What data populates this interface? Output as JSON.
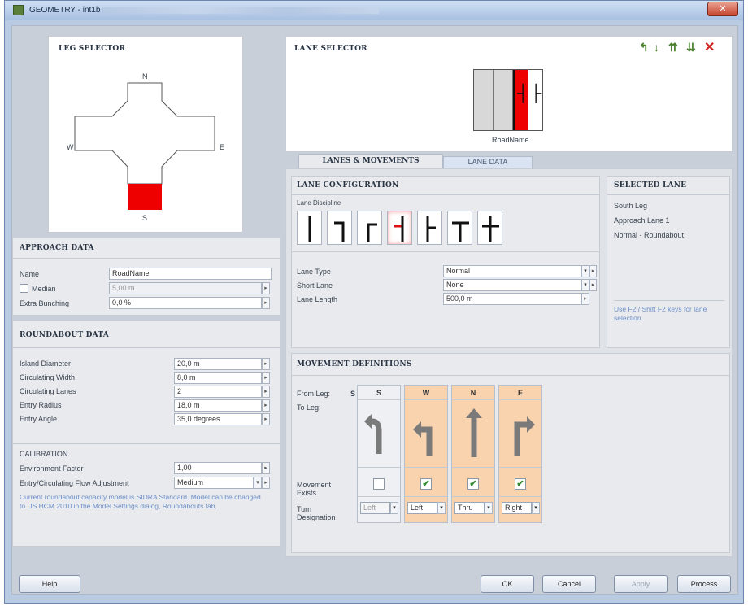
{
  "window": {
    "title": "GEOMETRY - int1b",
    "close": "✕"
  },
  "leg_selector": {
    "title": "LEG SELECTOR",
    "n": "N",
    "s": "S",
    "e": "E",
    "w": "W"
  },
  "lane_selector": {
    "title": "LANE SELECTOR",
    "road_name": "RoadName"
  },
  "tabs": {
    "lanes_movements": "LANES & MOVEMENTS",
    "lane_data": "LANE DATA"
  },
  "approach": {
    "title": "APPROACH DATA",
    "name_label": "Name",
    "name_value": "RoadName",
    "median_label": "Median",
    "median_value": "5,00 m",
    "bunching_label": "Extra Bunching",
    "bunching_value": "0,0 %"
  },
  "roundabout": {
    "title": "ROUNDABOUT DATA",
    "rows": [
      {
        "label": "Island Diameter",
        "value": "20,0 m"
      },
      {
        "label": "Circulating Width",
        "value": "8,0 m"
      },
      {
        "label": "Circulating Lanes",
        "value": "2"
      },
      {
        "label": "Entry Radius",
        "value": "18,0 m"
      },
      {
        "label": "Entry Angle",
        "value": "35,0 degrees"
      }
    ]
  },
  "calibration": {
    "title": "CALIBRATION",
    "env_label": "Environment Factor",
    "env_value": "1,00",
    "flow_label": "Entry/Circulating Flow Adjustment",
    "flow_value": "Medium",
    "note": "Current roundabout capacity model is SIDRA Standard. Model can be changed to US HCM 2010 in the Model Settings dialog, Roundabouts tab."
  },
  "lane_config": {
    "title": "LANE CONFIGURATION",
    "discipline_label": "Lane Discipline",
    "lane_type_label": "Lane Type",
    "lane_type_value": "Normal",
    "short_lane_label": "Short Lane",
    "short_lane_value": "None",
    "lane_length_label": "Lane Length",
    "lane_length_value": "500,0 m"
  },
  "selected_lane": {
    "title": "SELECTED LANE",
    "line1": "South Leg",
    "line2": "Approach Lane 1",
    "line3": "Normal - Roundabout",
    "hint": "Use F2 / Shift F2 keys for lane selection."
  },
  "movement": {
    "title": "MOVEMENT DEFINITIONS",
    "from_label": "From Leg:",
    "from_value": "S",
    "to_label": "To Leg:",
    "exists_label": "Movement Exists",
    "turn_label": "Turn Designation",
    "cols": [
      {
        "leg": "S",
        "turn": "Left",
        "checked": false
      },
      {
        "leg": "W",
        "turn": "Left",
        "checked": true
      },
      {
        "leg": "N",
        "turn": "Thru",
        "checked": true
      },
      {
        "leg": "E",
        "turn": "Right",
        "checked": true
      }
    ]
  },
  "buttons": {
    "help": "Help",
    "ok": "OK",
    "cancel": "Cancel",
    "apply": "Apply",
    "process": "Process"
  },
  "colors": {
    "selected": "#ee0000",
    "highlight": "#f9d3ae"
  }
}
